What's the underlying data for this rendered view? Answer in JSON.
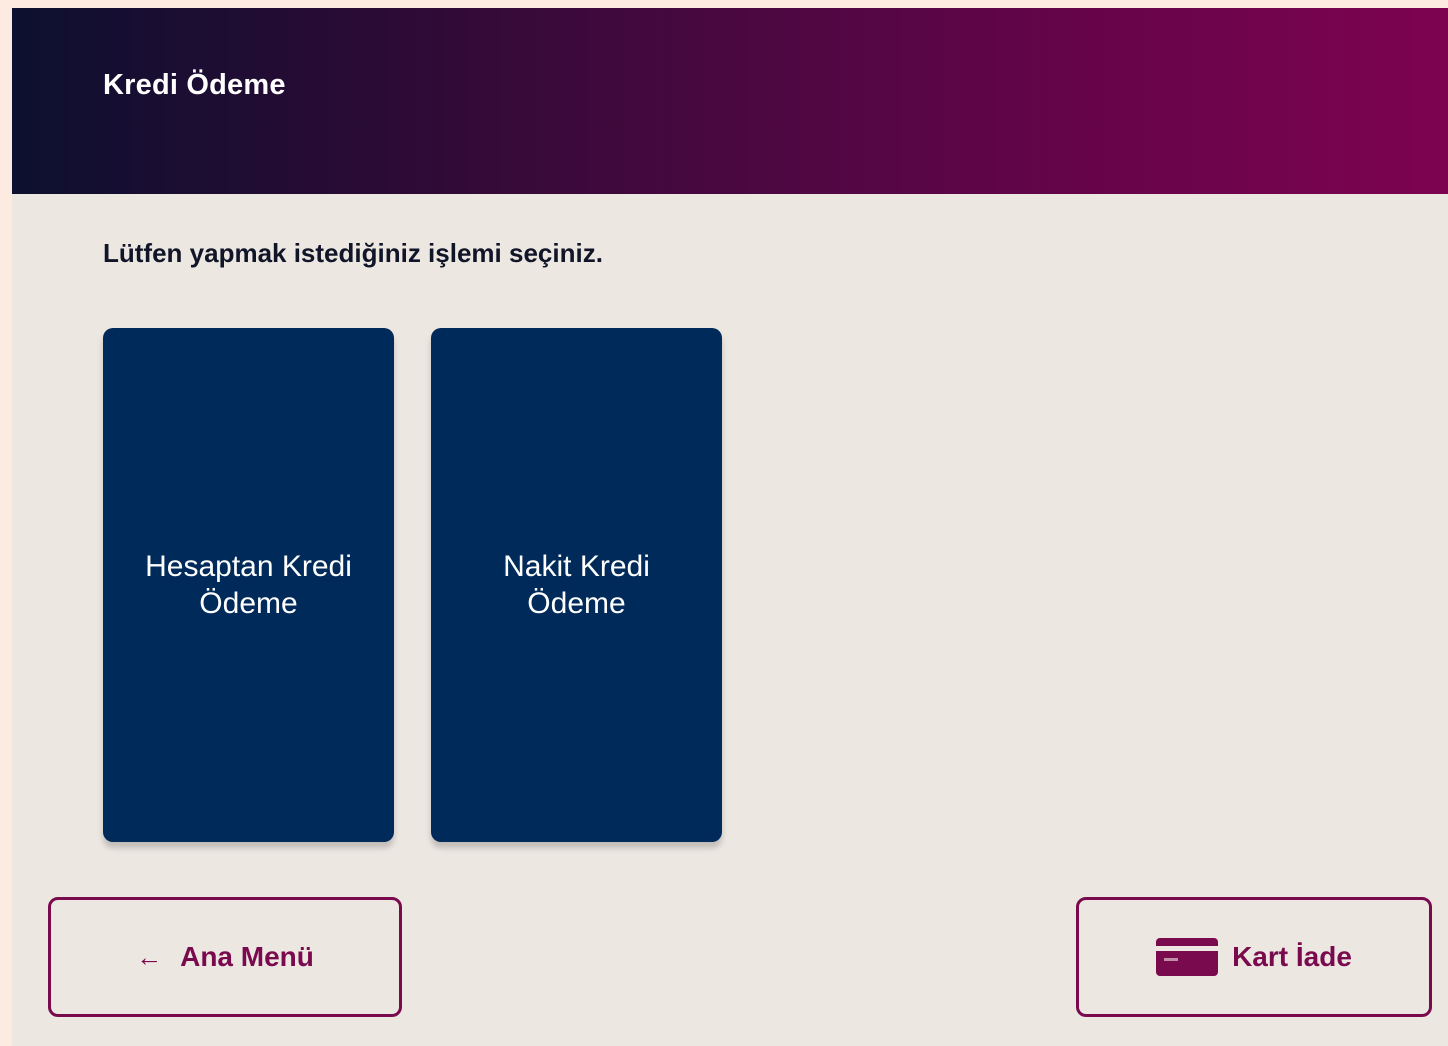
{
  "header": {
    "title": "Kredi Ödeme"
  },
  "main": {
    "instruction": "Lütfen yapmak istediğiniz işlemi seçiniz.",
    "options": [
      {
        "label": "Hesaptan Kredi Ödeme"
      },
      {
        "label": "Nakit Kredi Ödeme"
      }
    ]
  },
  "footer": {
    "home_button": {
      "label": "Ana Menü",
      "icon": "arrow-left-icon"
    },
    "card_return_button": {
      "label": "Kart İade",
      "icon": "credit-card-icon"
    }
  },
  "colors": {
    "header_gradient_start": "#0d1030",
    "header_gradient_end": "#7d0350",
    "tile_background": "#002a5a",
    "accent": "#7a0a4e",
    "page_background": "#ede7e2"
  }
}
